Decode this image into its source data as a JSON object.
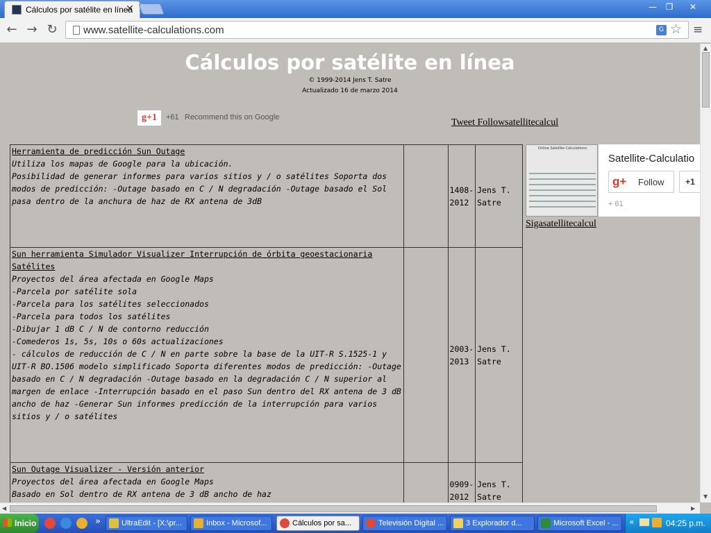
{
  "browser": {
    "tab_title": "Cálculos por satélite en línea",
    "tab_close": "✕",
    "url": "www.satellite-calculations.com",
    "win_minimize": "—",
    "win_restore": "❐",
    "win_close": "✕",
    "back": "←",
    "forward": "→",
    "reload": "↻",
    "star": "☆",
    "menu": "≡",
    "translate": "G"
  },
  "page": {
    "title": "Cálculos por satélite en línea",
    "copyright": "© 1999-2014 Jens T. Satre",
    "updated": "Actualizado 16 de marzo 2014",
    "gplus_label": "g+1",
    "gplus_count": "+61",
    "gplus_text": "Recommend this on Google",
    "tweet_link": "Tweet Followsatellitecalcul",
    "siga_link": "Sigasatellitecalcul",
    "thumb_title": "Online Satellite Calculations"
  },
  "follow_card": {
    "name": "Satellite-Calculatio",
    "gplus": "g+",
    "follow": "Follow",
    "plus1": "+1",
    "count": "+ 61"
  },
  "tools": [
    {
      "title": "Herramienta de predicción Sun Outage",
      "lines": [
        "Utiliza los mapas de Google para la ubicación.",
        "Posibilidad de generar informes para varios sitios y / o satélites Soporta dos modos de predicción: -Outage basado en C / N degradación -Outage basado el Sol pasa dentro de la anchura de haz de RX antena de 3dB"
      ],
      "year": "1408-2012",
      "author": "Jens T. Satre"
    },
    {
      "title": "Sun herramienta Simulador Visualizer Interrupción de órbita geoestacionaria Satélites",
      "lines": [
        "Proyectos del área afectada en Google Maps",
        "-Parcela por satélite sola",
        "-Parcela para los satélites seleccionados",
        "-Parcela para todos los satélites",
        "-Dibujar 1 dB C / N de contorno reducción",
        "-Comederos 1s, 5s, 10s o 60s actualizaciones",
        "- cálculos de reducción de C / N en parte sobre la base de la UIT-R S.1525-1 y UIT-R BO.1506 modelo simplificado Soporta diferentes modos de predicción: -Outage basado en C / N degradación -Outage basado en la degradación C / N superior al margen de enlace -Interrupción basado en el paso Sun dentro del RX antena de 3 dB ancho de haz -Generar Sun informes predicción de la interrupción para varios sitios y / o satélites"
      ],
      "year": "2003-2013",
      "author": "Jens T. Satre"
    },
    {
      "title": "Sun Outage Visualizer - Versión anterior",
      "lines": [
        "Proyectos del área afectada en Google Maps",
        "Basado en Sol dentro de RX antena de 3 dB ancho de haz"
      ],
      "year": "0909-2012",
      "author": "Jens T. Satre"
    }
  ],
  "taskbar": {
    "start": "Inicio",
    "chevron": "»",
    "items": [
      "UltraEdit - [X:\\pr...",
      "Inbox - Microsof...",
      "Cálculos por sa...",
      "Televisión Digital ...",
      "3 Explorador d...",
      "Microsoft Excel - ..."
    ],
    "tray_chevron": "«",
    "time": "04:25 p.m."
  },
  "colors": {
    "page_bg": "#c0bcb8",
    "titlebar": "#2f6ccc",
    "taskbar": "#2350b8",
    "start": "#2e882e",
    "gplus_red": "#d8372a"
  }
}
